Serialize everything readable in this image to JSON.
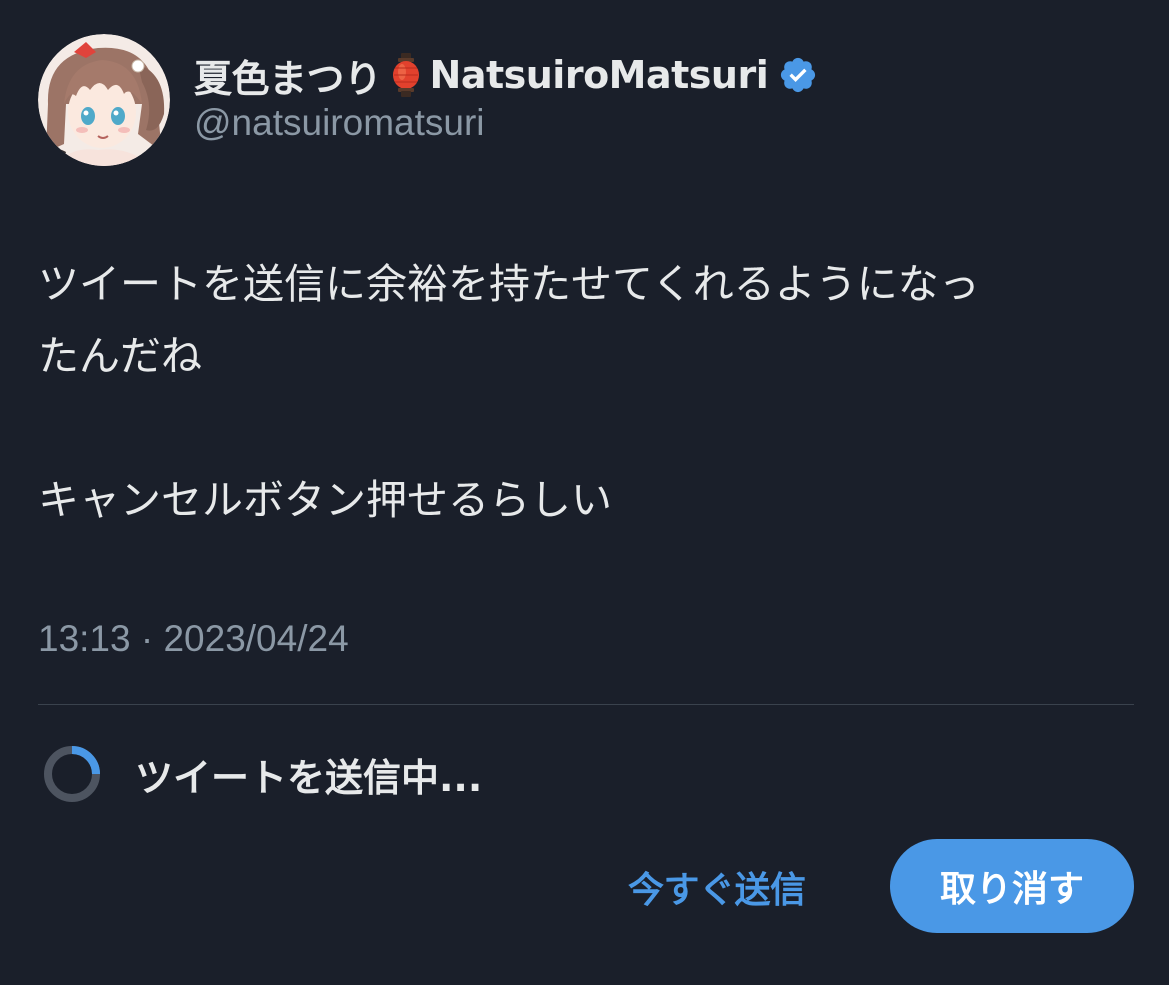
{
  "author": {
    "display_name": "夏色まつり",
    "display_name_suffix": "NatsuiroMatsuri",
    "handle": "@natsuiromatsuri",
    "name_emoji_icon": "red-paper-lantern-icon",
    "verified_icon": "verified-badge-icon",
    "avatar_icon": "avatar"
  },
  "tweet": {
    "text_line_1": "ツイートを送信に余裕を持たせてくれるようになっ",
    "text_line_2": "たんだね",
    "text_line_3": "キャンセルボタン押せるらしい",
    "timestamp": "13:13 · 2023/04/24"
  },
  "sending": {
    "label": "ツイートを送信中...",
    "spinner_icon": "loading-spinner-icon"
  },
  "actions": {
    "send_now_label": "今すぐ送信",
    "cancel_label": "取り消す"
  },
  "colors": {
    "background": "#1a1f2a",
    "accent": "#4a98e6",
    "text_primary": "#e7e9ea",
    "text_secondary": "#8b98a5",
    "divider": "#3a424d"
  }
}
